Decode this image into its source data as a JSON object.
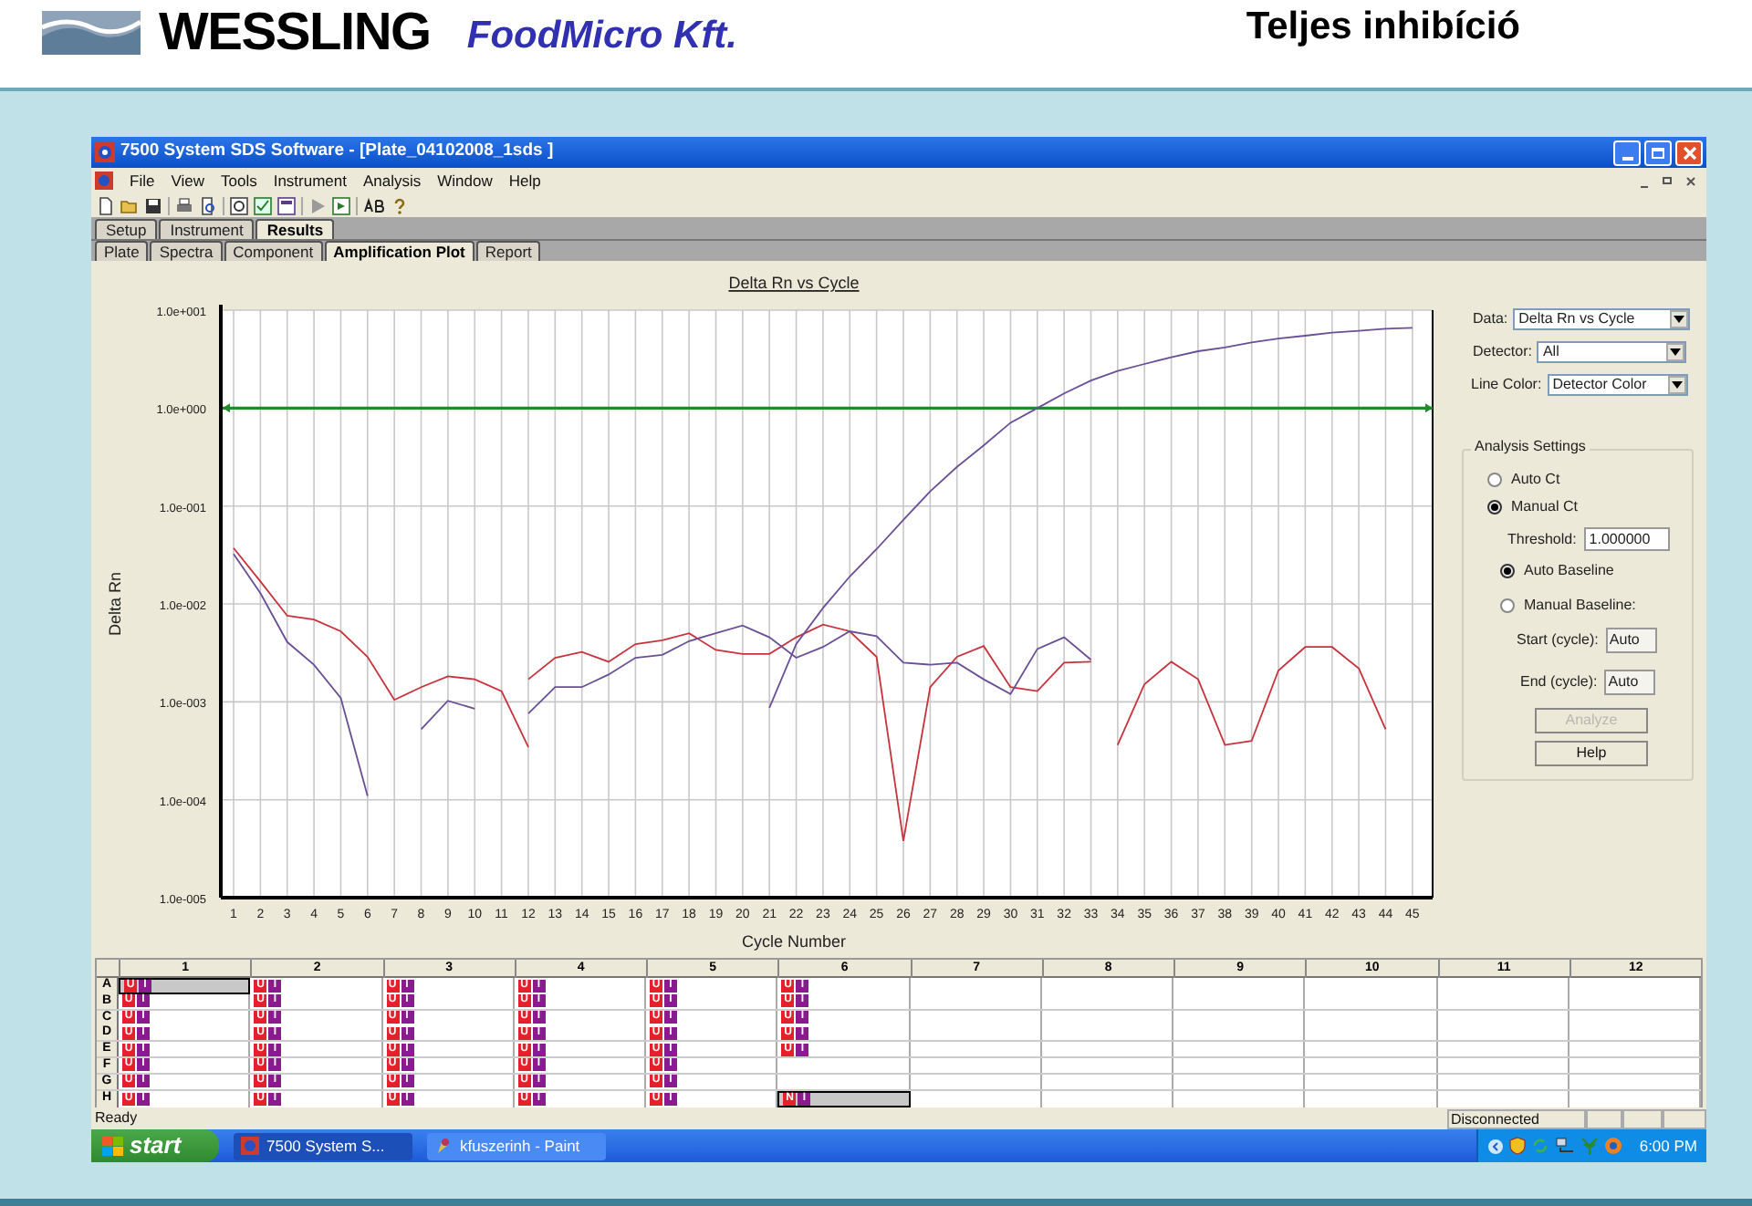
{
  "slide": {
    "brand": "WESSLING",
    "company": "FoodMicro Kft.",
    "title": "Teljes inhibíció"
  },
  "window": {
    "title": "7500 System SDS Software - [Plate_04102008_1sds ]"
  },
  "menu": [
    "File",
    "View",
    "Tools",
    "Instrument",
    "Analysis",
    "Window",
    "Help"
  ],
  "tabs": [
    {
      "label": "Setup",
      "selected": false
    },
    {
      "label": "Instrument",
      "selected": false
    },
    {
      "label": "Results",
      "selected": true
    }
  ],
  "subtabs": [
    {
      "label": "Plate",
      "selected": false
    },
    {
      "label": "Spectra",
      "selected": false
    },
    {
      "label": "Component",
      "selected": false
    },
    {
      "label": "Amplification Plot",
      "selected": true
    },
    {
      "label": "Report",
      "selected": false
    }
  ],
  "plot": {
    "title": "Delta Rn vs Cycle",
    "xlabel": "Cycle Number",
    "ylabel": "Delta Rn",
    "x_labels": [
      "1",
      "2",
      "3",
      "4",
      "5",
      "6",
      "7",
      "8",
      "9",
      "10",
      "11",
      "12",
      "13",
      "14",
      "15",
      "16",
      "17",
      "18",
      "19",
      "20",
      "21",
      "22",
      "23",
      "24",
      "25",
      "26",
      "27",
      "28",
      "29",
      "30",
      "31",
      "32",
      "33",
      "34",
      "35",
      "36",
      "37",
      "38",
      "39",
      "40",
      "41",
      "42",
      "43",
      "44",
      "45"
    ],
    "y_labels": [
      "1.0e+001",
      "1.0e+000",
      "1.0e-001",
      "1.0e-002",
      "1.0e-003",
      "1.0e-004",
      "1.0e-005"
    ]
  },
  "settings": {
    "data_label": "Data:",
    "data_value": "Delta Rn vs Cycle",
    "detector_label": "Detector:",
    "detector_value": "All",
    "line_color_label": "Line Color:",
    "line_color_value": "Detector Color",
    "group_title": "Analysis Settings",
    "ct_options": [
      {
        "label": "Auto Ct",
        "selected": false
      },
      {
        "label": "Manual Ct",
        "selected": true
      }
    ],
    "threshold_label": "Threshold:",
    "threshold_value": "1.000000",
    "baseline_options": [
      {
        "label": "Auto Baseline",
        "selected": true
      },
      {
        "label": "Manual Baseline:",
        "selected": false
      }
    ],
    "start_label": "Start (cycle):",
    "start_value": "Auto",
    "end_label": "End (cycle):",
    "end_value": "Auto",
    "buttons": [
      {
        "label": "Analyze",
        "disabled": true
      },
      {
        "label": "Help",
        "disabled": false
      }
    ]
  },
  "plate": {
    "columns": [
      "1",
      "2",
      "3",
      "4",
      "5",
      "6",
      "7",
      "8",
      "9",
      "10",
      "11",
      "12"
    ],
    "rows": [
      {
        "label": "A",
        "wells": [
          {
            "selected": true,
            "tags": [
              {
                "text": "U",
                "color": "#e4202c"
              },
              {
                "text": "I",
                "color": "#8b1a8f"
              }
            ]
          },
          {
            "selected": false,
            "tags": [
              {
                "text": "U",
                "color": "#e4202c"
              },
              {
                "text": "I",
                "color": "#8b1a8f"
              }
            ]
          },
          {
            "selected": false,
            "tags": [
              {
                "text": "U",
                "color": "#e4202c"
              },
              {
                "text": "I",
                "color": "#8b1a8f"
              }
            ]
          },
          {
            "selected": false,
            "tags": [
              {
                "text": "U",
                "color": "#e4202c"
              },
              {
                "text": "I",
                "color": "#8b1a8f"
              }
            ]
          },
          {
            "selected": false,
            "tags": [
              {
                "text": "U",
                "color": "#e4202c"
              },
              {
                "text": "I",
                "color": "#8b1a8f"
              }
            ]
          },
          {
            "selected": false,
            "tags": [
              {
                "text": "U",
                "color": "#e4202c"
              },
              {
                "text": "I",
                "color": "#8b1a8f"
              }
            ]
          },
          {
            "selected": false
          },
          {
            "selected": false
          },
          {
            "selected": false
          },
          {
            "selected": false
          },
          {
            "selected": false
          },
          {
            "selected": false
          }
        ]
      },
      {
        "label": "B",
        "wells": [
          {
            "selected": false,
            "tags": [
              {
                "text": "U",
                "color": "#e4202c"
              },
              {
                "text": "I",
                "color": "#8b1a8f"
              }
            ]
          },
          {
            "selected": false,
            "tags": [
              {
                "text": "U",
                "color": "#e4202c"
              },
              {
                "text": "I",
                "color": "#8b1a8f"
              }
            ]
          },
          {
            "selected": false,
            "tags": [
              {
                "text": "U",
                "color": "#e4202c"
              },
              {
                "text": "I",
                "color": "#8b1a8f"
              }
            ]
          },
          {
            "selected": false,
            "tags": [
              {
                "text": "U",
                "color": "#e4202c"
              },
              {
                "text": "I",
                "color": "#8b1a8f"
              }
            ]
          },
          {
            "selected": false,
            "tags": [
              {
                "text": "U",
                "color": "#e4202c"
              },
              {
                "text": "I",
                "color": "#8b1a8f"
              }
            ]
          },
          {
            "selected": false,
            "tags": [
              {
                "text": "U",
                "color": "#e4202c"
              },
              {
                "text": "I",
                "color": "#8b1a8f"
              }
            ]
          },
          {
            "selected": false
          },
          {
            "selected": false
          },
          {
            "selected": false
          },
          {
            "selected": false
          },
          {
            "selected": false
          },
          {
            "selected": false
          }
        ]
      },
      {
        "label": "C",
        "wells": [
          {
            "selected": false,
            "tags": [
              {
                "text": "U",
                "color": "#e4202c"
              },
              {
                "text": "I",
                "color": "#8b1a8f"
              }
            ]
          },
          {
            "selected": false,
            "tags": [
              {
                "text": "U",
                "color": "#e4202c"
              },
              {
                "text": "I",
                "color": "#8b1a8f"
              }
            ]
          },
          {
            "selected": false,
            "tags": [
              {
                "text": "U",
                "color": "#e4202c"
              },
              {
                "text": "I",
                "color": "#8b1a8f"
              }
            ]
          },
          {
            "selected": false,
            "tags": [
              {
                "text": "U",
                "color": "#e4202c"
              },
              {
                "text": "I",
                "color": "#8b1a8f"
              }
            ]
          },
          {
            "selected": false,
            "tags": [
              {
                "text": "U",
                "color": "#e4202c"
              },
              {
                "text": "I",
                "color": "#8b1a8f"
              }
            ]
          },
          {
            "selected": false,
            "tags": [
              {
                "text": "U",
                "color": "#e4202c"
              },
              {
                "text": "I",
                "color": "#8b1a8f"
              }
            ]
          },
          {
            "selected": false
          },
          {
            "selected": false
          },
          {
            "selected": false
          },
          {
            "selected": false
          },
          {
            "selected": false
          },
          {
            "selected": false
          }
        ]
      },
      {
        "label": "D",
        "wells": [
          {
            "selected": false,
            "tags": [
              {
                "text": "U",
                "color": "#e4202c"
              },
              {
                "text": "I",
                "color": "#8b1a8f"
              }
            ]
          },
          {
            "selected": false,
            "tags": [
              {
                "text": "U",
                "color": "#e4202c"
              },
              {
                "text": "I",
                "color": "#8b1a8f"
              }
            ]
          },
          {
            "selected": false,
            "tags": [
              {
                "text": "U",
                "color": "#e4202c"
              },
              {
                "text": "I",
                "color": "#8b1a8f"
              }
            ]
          },
          {
            "selected": false,
            "tags": [
              {
                "text": "U",
                "color": "#e4202c"
              },
              {
                "text": "I",
                "color": "#8b1a8f"
              }
            ]
          },
          {
            "selected": false,
            "tags": [
              {
                "text": "U",
                "color": "#e4202c"
              },
              {
                "text": "I",
                "color": "#8b1a8f"
              }
            ]
          },
          {
            "selected": false,
            "tags": [
              {
                "text": "U",
                "color": "#e4202c"
              },
              {
                "text": "I",
                "color": "#8b1a8f"
              }
            ]
          },
          {
            "selected": false
          },
          {
            "selected": false
          },
          {
            "selected": false
          },
          {
            "selected": false
          },
          {
            "selected": false
          },
          {
            "selected": false
          }
        ]
      },
      {
        "label": "E",
        "wells": [
          {
            "selected": false,
            "tags": [
              {
                "text": "U",
                "color": "#e4202c"
              },
              {
                "text": "I",
                "color": "#8b1a8f"
              }
            ]
          },
          {
            "selected": false,
            "tags": [
              {
                "text": "U",
                "color": "#e4202c"
              },
              {
                "text": "I",
                "color": "#8b1a8f"
              }
            ]
          },
          {
            "selected": false,
            "tags": [
              {
                "text": "U",
                "color": "#e4202c"
              },
              {
                "text": "I",
                "color": "#8b1a8f"
              }
            ]
          },
          {
            "selected": false,
            "tags": [
              {
                "text": "U",
                "color": "#e4202c"
              },
              {
                "text": "I",
                "color": "#8b1a8f"
              }
            ]
          },
          {
            "selected": false,
            "tags": [
              {
                "text": "U",
                "color": "#e4202c"
              },
              {
                "text": "I",
                "color": "#8b1a8f"
              }
            ]
          },
          {
            "selected": false,
            "tags": [
              {
                "text": "U",
                "color": "#e4202c"
              },
              {
                "text": "I",
                "color": "#8b1a8f"
              }
            ]
          },
          {
            "selected": false
          },
          {
            "selected": false
          },
          {
            "selected": false
          },
          {
            "selected": false
          },
          {
            "selected": false
          },
          {
            "selected": false
          }
        ]
      },
      {
        "label": "F",
        "wells": [
          {
            "selected": false,
            "tags": [
              {
                "text": "U",
                "color": "#e4202c"
              },
              {
                "text": "I",
                "color": "#8b1a8f"
              }
            ]
          },
          {
            "selected": false,
            "tags": [
              {
                "text": "U",
                "color": "#e4202c"
              },
              {
                "text": "I",
                "color": "#8b1a8f"
              }
            ]
          },
          {
            "selected": false,
            "tags": [
              {
                "text": "U",
                "color": "#e4202c"
              },
              {
                "text": "I",
                "color": "#8b1a8f"
              }
            ]
          },
          {
            "selected": false,
            "tags": [
              {
                "text": "U",
                "color": "#e4202c"
              },
              {
                "text": "I",
                "color": "#8b1a8f"
              }
            ]
          },
          {
            "selected": false,
            "tags": [
              {
                "text": "U",
                "color": "#e4202c"
              },
              {
                "text": "I",
                "color": "#8b1a8f"
              }
            ]
          },
          {
            "selected": false
          },
          {
            "selected": false
          },
          {
            "selected": false
          },
          {
            "selected": false
          },
          {
            "selected": false
          },
          {
            "selected": false
          },
          {
            "selected": false
          }
        ]
      },
      {
        "label": "G",
        "wells": [
          {
            "selected": false,
            "tags": [
              {
                "text": "U",
                "color": "#e4202c"
              },
              {
                "text": "I",
                "color": "#8b1a8f"
              }
            ]
          },
          {
            "selected": false,
            "tags": [
              {
                "text": "U",
                "color": "#e4202c"
              },
              {
                "text": "I",
                "color": "#8b1a8f"
              }
            ]
          },
          {
            "selected": false,
            "tags": [
              {
                "text": "U",
                "color": "#e4202c"
              },
              {
                "text": "I",
                "color": "#8b1a8f"
              }
            ]
          },
          {
            "selected": false,
            "tags": [
              {
                "text": "U",
                "color": "#e4202c"
              },
              {
                "text": "I",
                "color": "#8b1a8f"
              }
            ]
          },
          {
            "selected": false,
            "tags": [
              {
                "text": "U",
                "color": "#e4202c"
              },
              {
                "text": "I",
                "color": "#8b1a8f"
              }
            ]
          },
          {
            "selected": false
          },
          {
            "selected": false
          },
          {
            "selected": false
          },
          {
            "selected": false
          },
          {
            "selected": false
          },
          {
            "selected": false
          },
          {
            "selected": false
          }
        ]
      },
      {
        "label": "H",
        "wells": [
          {
            "selected": false,
            "tags": [
              {
                "text": "U",
                "color": "#e4202c"
              },
              {
                "text": "I",
                "color": "#8b1a8f"
              }
            ]
          },
          {
            "selected": false,
            "tags": [
              {
                "text": "U",
                "color": "#e4202c"
              },
              {
                "text": "I",
                "color": "#8b1a8f"
              }
            ]
          },
          {
            "selected": false,
            "tags": [
              {
                "text": "U",
                "color": "#e4202c"
              },
              {
                "text": "I",
                "color": "#8b1a8f"
              }
            ]
          },
          {
            "selected": false,
            "tags": [
              {
                "text": "U",
                "color": "#e4202c"
              },
              {
                "text": "I",
                "color": "#8b1a8f"
              }
            ]
          },
          {
            "selected": false,
            "tags": [
              {
                "text": "U",
                "color": "#e4202c"
              },
              {
                "text": "I",
                "color": "#8b1a8f"
              }
            ]
          },
          {
            "selected": true,
            "tags": [
              {
                "text": "N",
                "color": "#e4202c"
              },
              {
                "text": "I",
                "color": "#8b1a8f"
              }
            ]
          },
          {
            "selected": false
          },
          {
            "selected": false
          },
          {
            "selected": false
          },
          {
            "selected": false
          },
          {
            "selected": false
          },
          {
            "selected": false
          }
        ]
      }
    ]
  },
  "status_bar": {
    "left": "Ready",
    "right": "Disconnected"
  },
  "taskbar": {
    "start": "start",
    "tasks": [
      {
        "label": "7500 System S...",
        "selected": true
      },
      {
        "label": "kfuszerinh - Paint",
        "selected": false
      }
    ],
    "time": "6:00 PM"
  }
}
